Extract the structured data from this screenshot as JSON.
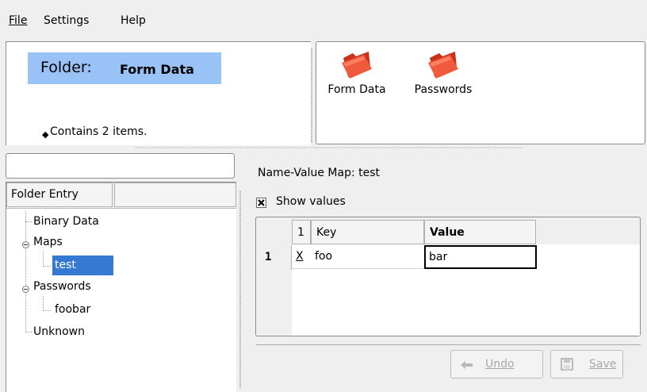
{
  "menubar": {
    "file": "File",
    "settings": "Settings",
    "help": "Help"
  },
  "info_panel": {
    "folder_prefix": "Folder:",
    "folder_name": "Form Data",
    "contains": "Contains 2 items."
  },
  "icon_panel": {
    "folders": [
      {
        "label": "Form Data",
        "icon": "folder-icon"
      },
      {
        "label": "Passwords",
        "icon": "folder-icon"
      }
    ]
  },
  "search": {
    "value": "",
    "placeholder": ""
  },
  "tree": {
    "column_header": "Folder Entry",
    "items": [
      {
        "label": "Binary Data"
      },
      {
        "label": "Maps",
        "expanded": true,
        "children": [
          {
            "label": "test",
            "selected": true
          }
        ]
      },
      {
        "label": "Passwords",
        "expanded": true,
        "children": [
          {
            "label": "foobar"
          }
        ]
      },
      {
        "label": "Unknown"
      }
    ]
  },
  "detail": {
    "title": "Name-Value Map: test",
    "show_values_label": "Show values",
    "show_values_checked": true,
    "table": {
      "columns": [
        "1",
        "Key",
        "Value"
      ],
      "rows": [
        {
          "row_header": "1",
          "delete": "X",
          "key": "foo",
          "value": "bar"
        }
      ]
    },
    "buttons": {
      "undo": "Undo",
      "save": "Save"
    }
  },
  "colors": {
    "selection": "#3679d2",
    "header_highlight": "#99c3f6",
    "window_bg": "#efefef",
    "folder_icon": "#e64a2e"
  }
}
